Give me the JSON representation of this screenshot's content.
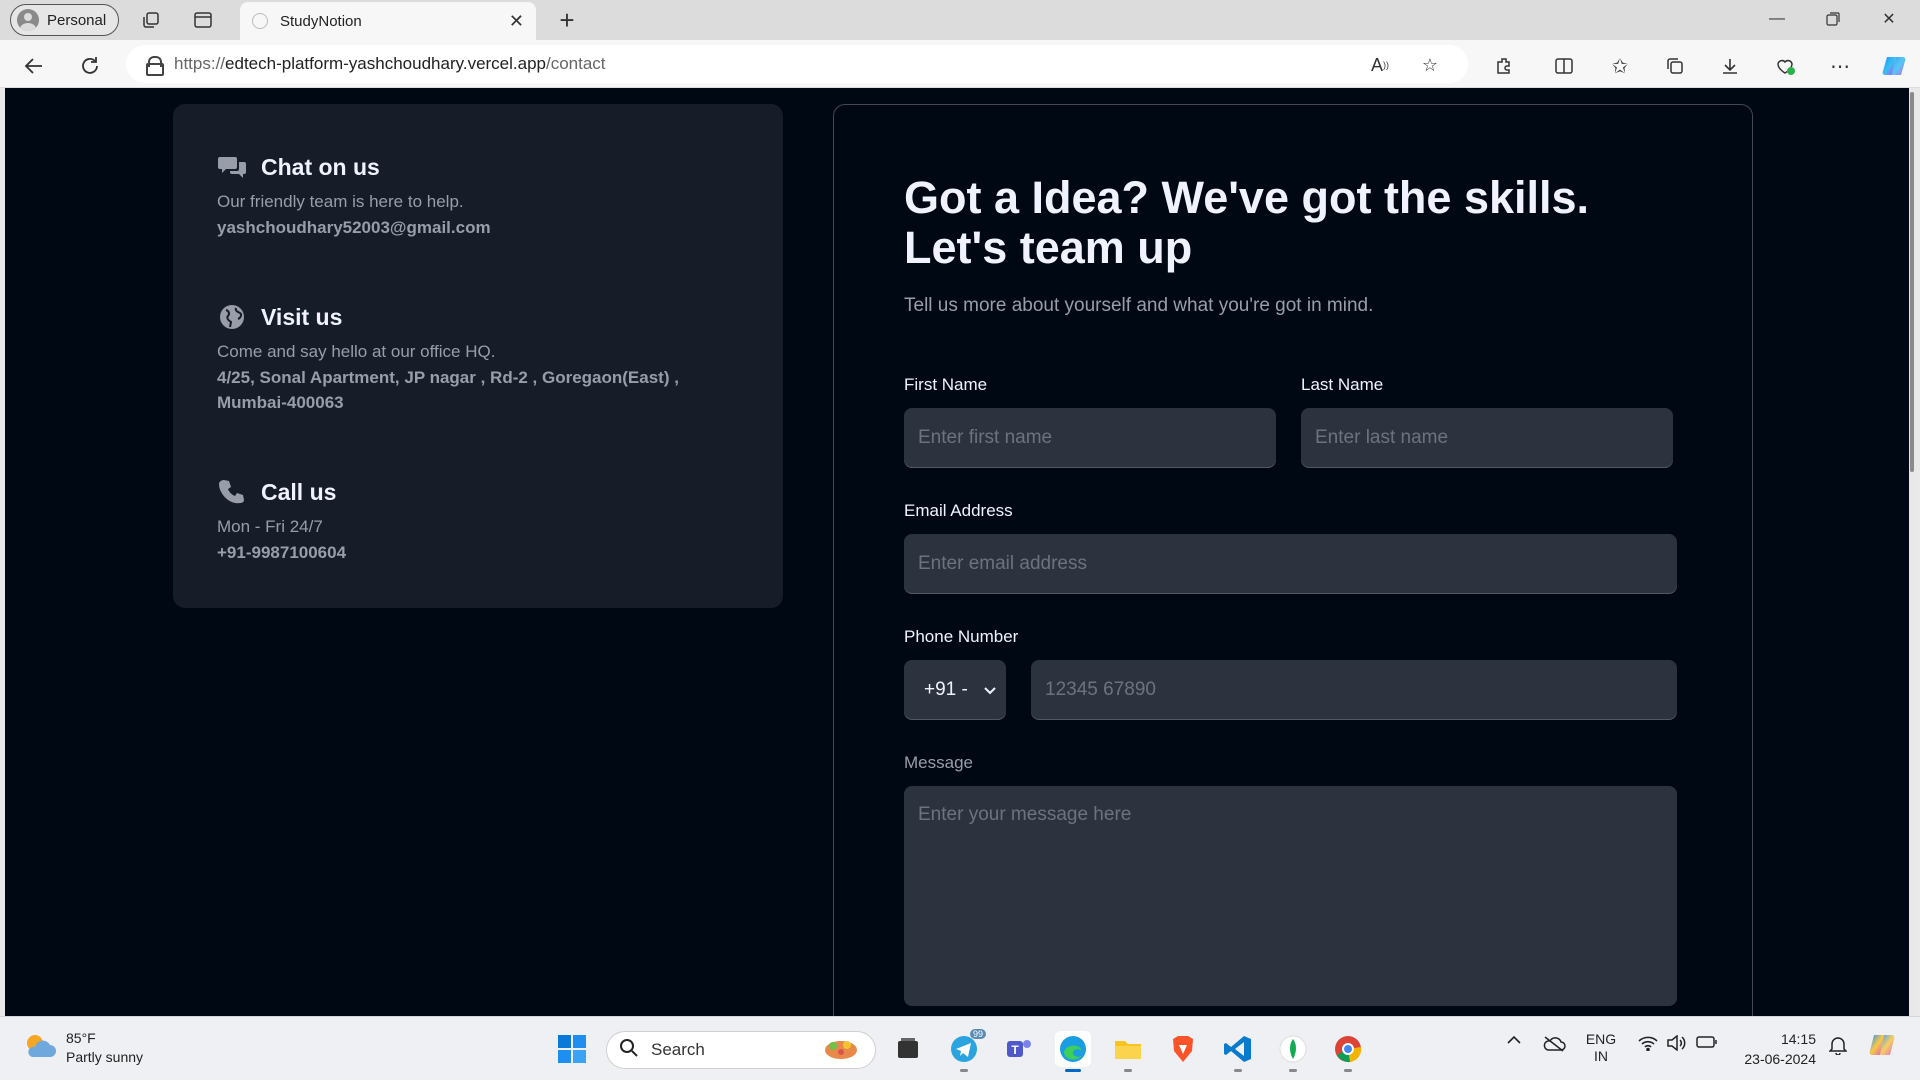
{
  "browser": {
    "profile_label": "Personal",
    "tab_title": "StudyNotion",
    "url_prefix": "https://",
    "url_host": "edtech-platform-yashchoudhary.vercel.app",
    "url_path": "/contact"
  },
  "contact": {
    "chat": {
      "icon": "chat-bubbles-icon",
      "title": "Chat on us",
      "description": "Our friendly team is here to help.",
      "info": "yashchoudhary52003@gmail.com"
    },
    "visit": {
      "icon": "globe-icon",
      "title": "Visit us",
      "description": "Come and say hello at our office HQ.",
      "info": "4/25, Sonal Apartment, JP nagar , Rd-2 , Goregaon(East) , Mumbai-400063"
    },
    "call": {
      "icon": "phone-icon",
      "title": "Call us",
      "description": "Mon - Fri 24/7",
      "info": "+91-9987100604"
    }
  },
  "form": {
    "heading": "Got a Idea? We've got the skills. Let's team up",
    "subheading": "Tell us more about yourself and what you're got in mind.",
    "first_name": {
      "label": "First Name",
      "placeholder": "Enter first name"
    },
    "last_name": {
      "label": "Last Name",
      "placeholder": "Enter last name"
    },
    "email": {
      "label": "Email Address",
      "placeholder": "Enter email address"
    },
    "phone": {
      "label": "Phone Number",
      "country_code": "+91 -",
      "placeholder": "12345 67890"
    },
    "message": {
      "label": "Message",
      "placeholder": "Enter your message here"
    }
  },
  "taskbar": {
    "weather_temp": "85°F",
    "weather_desc": "Partly sunny",
    "search_label": "Search",
    "telegram_badge": "99",
    "lang_line1": "ENG",
    "lang_line2": "IN",
    "time": "14:15",
    "date": "23-06-2024"
  },
  "colors": {
    "page_bg": "#000814",
    "card_bg": "#161d29",
    "input_bg": "#2c333f",
    "heading": "#f1f2ff",
    "muted_text": "#999daa"
  }
}
